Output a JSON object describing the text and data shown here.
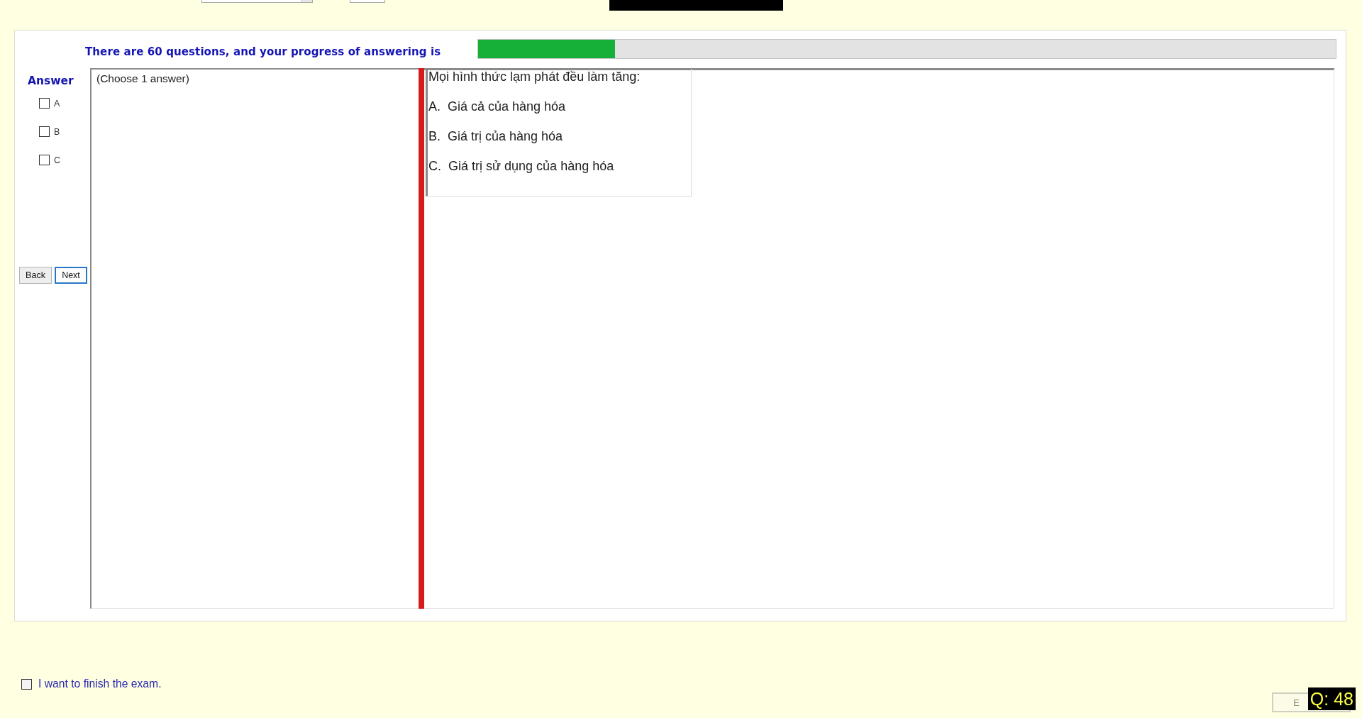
{
  "progress": {
    "label": "There are 60 questions, and your progress of answering is",
    "level": 0.16
  },
  "answer_panel": {
    "title": "Answer",
    "options": [
      {
        "label": "A",
        "checked": false
      },
      {
        "label": "B",
        "checked": false
      },
      {
        "label": "C",
        "checked": false
      }
    ]
  },
  "navigation": {
    "buttons": [
      {
        "label": "Back",
        "focused": false
      },
      {
        "label": "Next",
        "focused": true
      }
    ]
  },
  "instruction": "(Choose 1 answer)",
  "question": {
    "text": "Mọi hình thức lạm phát đều làm tăng:",
    "choices": [
      "A.  Giá cả của hàng hóa",
      "B.  Giá trị của hàng hóa",
      "C.  Giá trị sử dụng của hàng hóa"
    ]
  },
  "finish": {
    "label": "I want to finish the exam.",
    "checked": false
  },
  "bottom_right": {
    "button_label": "E",
    "question_badge": "Q: 48"
  }
}
